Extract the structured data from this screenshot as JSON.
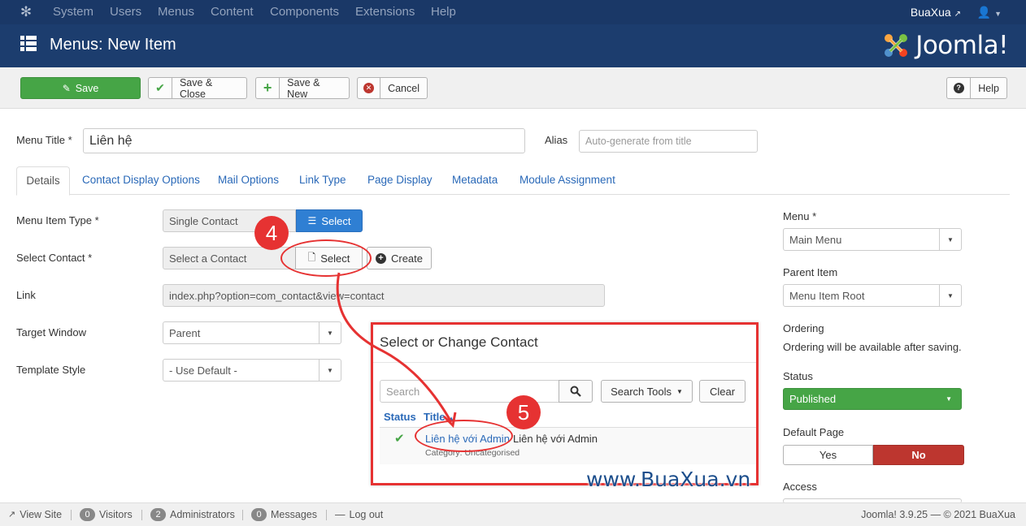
{
  "topnav": {
    "items": [
      "System",
      "Users",
      "Menus",
      "Content",
      "Components",
      "Extensions",
      "Help"
    ],
    "site_name": "BuaXua"
  },
  "header": {
    "title": "Menus: New Item",
    "logo_text": "Joomla!"
  },
  "toolbar": {
    "save": "Save",
    "save_close": "Save & Close",
    "save_new": "Save & New",
    "cancel": "Cancel",
    "help": "Help"
  },
  "form": {
    "menu_title_label": "Menu Title *",
    "menu_title_value": "Liên hệ",
    "alias_label": "Alias",
    "alias_placeholder": "Auto-generate from title"
  },
  "tabs": [
    "Details",
    "Contact Display Options",
    "Mail Options",
    "Link Type",
    "Page Display",
    "Metadata",
    "Module Assignment"
  ],
  "details": {
    "menu_item_type_label": "Menu Item Type *",
    "menu_item_type_value": "Single Contact",
    "select_button": "Select",
    "select_contact_label": "Select Contact *",
    "select_contact_value": "Select a Contact",
    "contact_select_button": "Select",
    "create_button": "Create",
    "link_label": "Link",
    "link_value": "index.php?option=com_contact&view=contact",
    "target_window_label": "Target Window",
    "target_window_value": "Parent",
    "template_style_label": "Template Style",
    "template_style_value": "- Use Default -"
  },
  "sidebar": {
    "menu_label": "Menu *",
    "menu_value": "Main Menu",
    "parent_label": "Parent Item",
    "parent_value": "Menu Item Root",
    "ordering_label": "Ordering",
    "ordering_text": "Ordering will be available after saving.",
    "status_label": "Status",
    "status_value": "Published",
    "default_page_label": "Default Page",
    "yes": "Yes",
    "no": "No",
    "access_label": "Access"
  },
  "modal": {
    "title": "Select or Change Contact",
    "search_placeholder": "Search",
    "search_tools": "Search Tools",
    "clear": "Clear",
    "col_status": "Status",
    "col_title": "Title",
    "rows": [
      {
        "link": "Liên hệ với Admin",
        "text": "Liên hệ với Admin",
        "category": "Category: Uncategorised"
      }
    ]
  },
  "annotations": {
    "step4": "4",
    "step5": "5",
    "watermark": "www.BuaXua.vn"
  },
  "footer": {
    "view_site": "View Site",
    "visitors_count": "0",
    "visitors": "Visitors",
    "admins_count": "2",
    "admins": "Administrators",
    "messages_count": "0",
    "messages": "Messages",
    "logout": "Log out",
    "version": "Joomla! 3.9.25 — © 2021 BuaXua"
  },
  "colors": {
    "navbar": "#1a3867",
    "header": "#1c3d6e",
    "save": "#46a546",
    "primary": "#2f7fd3",
    "danger": "#bd362f",
    "annotation": "#e63232"
  }
}
